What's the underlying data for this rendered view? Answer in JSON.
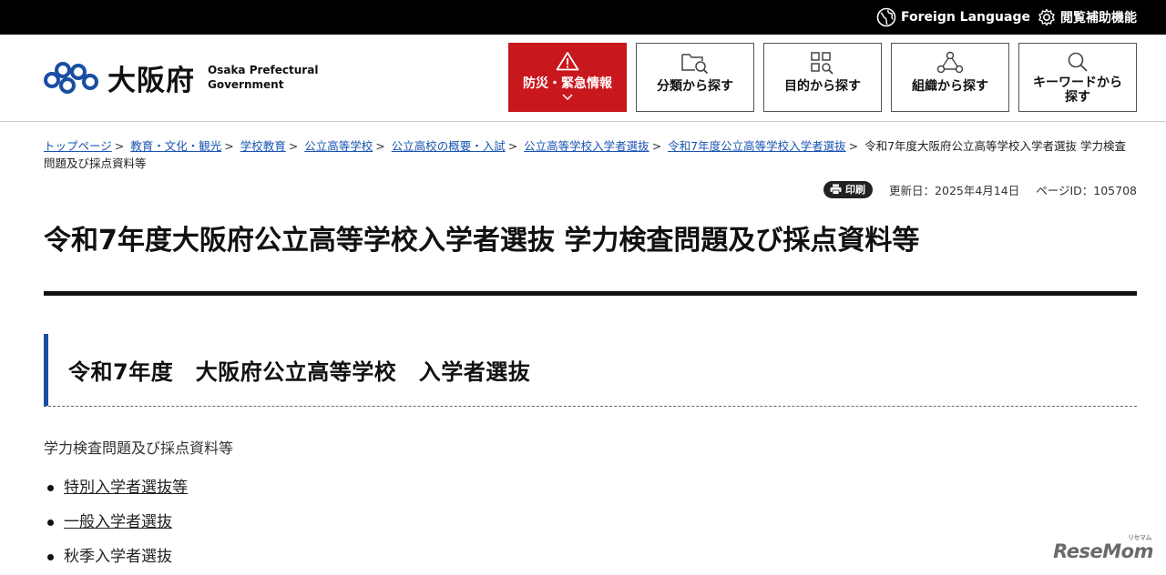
{
  "topbar": {
    "foreign_language": "Foreign Language",
    "accessibility": "閲覧補助機能"
  },
  "header": {
    "logo_jp": "大阪府",
    "logo_en_line1": "Osaka Prefectural",
    "logo_en_line2": "Government",
    "nav": {
      "disaster": "防災・緊急情報",
      "category": "分類から探す",
      "purpose": "目的から探す",
      "organization": "組織から探す",
      "keyword_line1": "キーワードから",
      "keyword_line2": "探す"
    }
  },
  "breadcrumb": {
    "items": [
      "トップページ",
      "教育・文化・観光",
      "学校教育",
      "公立高等学校",
      "公立高校の概要・入試",
      "公立高等学校入学者選抜",
      "令和7年度公立高等学校入学者選抜"
    ],
    "current": "令和7年度大阪府公立高等学校入学者選抜 学力検査問題及び採点資料等"
  },
  "meta": {
    "print": "印刷",
    "updated": "更新日：2025年4月14日",
    "page_id": "ページID：105708"
  },
  "main": {
    "title": "令和7年度大阪府公立高等学校入学者選抜 学力検査問題及び採点資料等",
    "section_heading": "令和7年度　大阪府公立高等学校　入学者選抜",
    "intro": "学力検査問題及び採点資料等",
    "links": [
      "特別入学者選抜等",
      "一般入学者選抜"
    ],
    "plain_item": "秋季入学者選抜"
  },
  "watermark": {
    "text": "ReseMom",
    "sub": "リセマム"
  },
  "colors": {
    "disaster_red": "#c8171d",
    "logo_blue": "#1a4ea3",
    "link_blue": "#1a55b3"
  }
}
